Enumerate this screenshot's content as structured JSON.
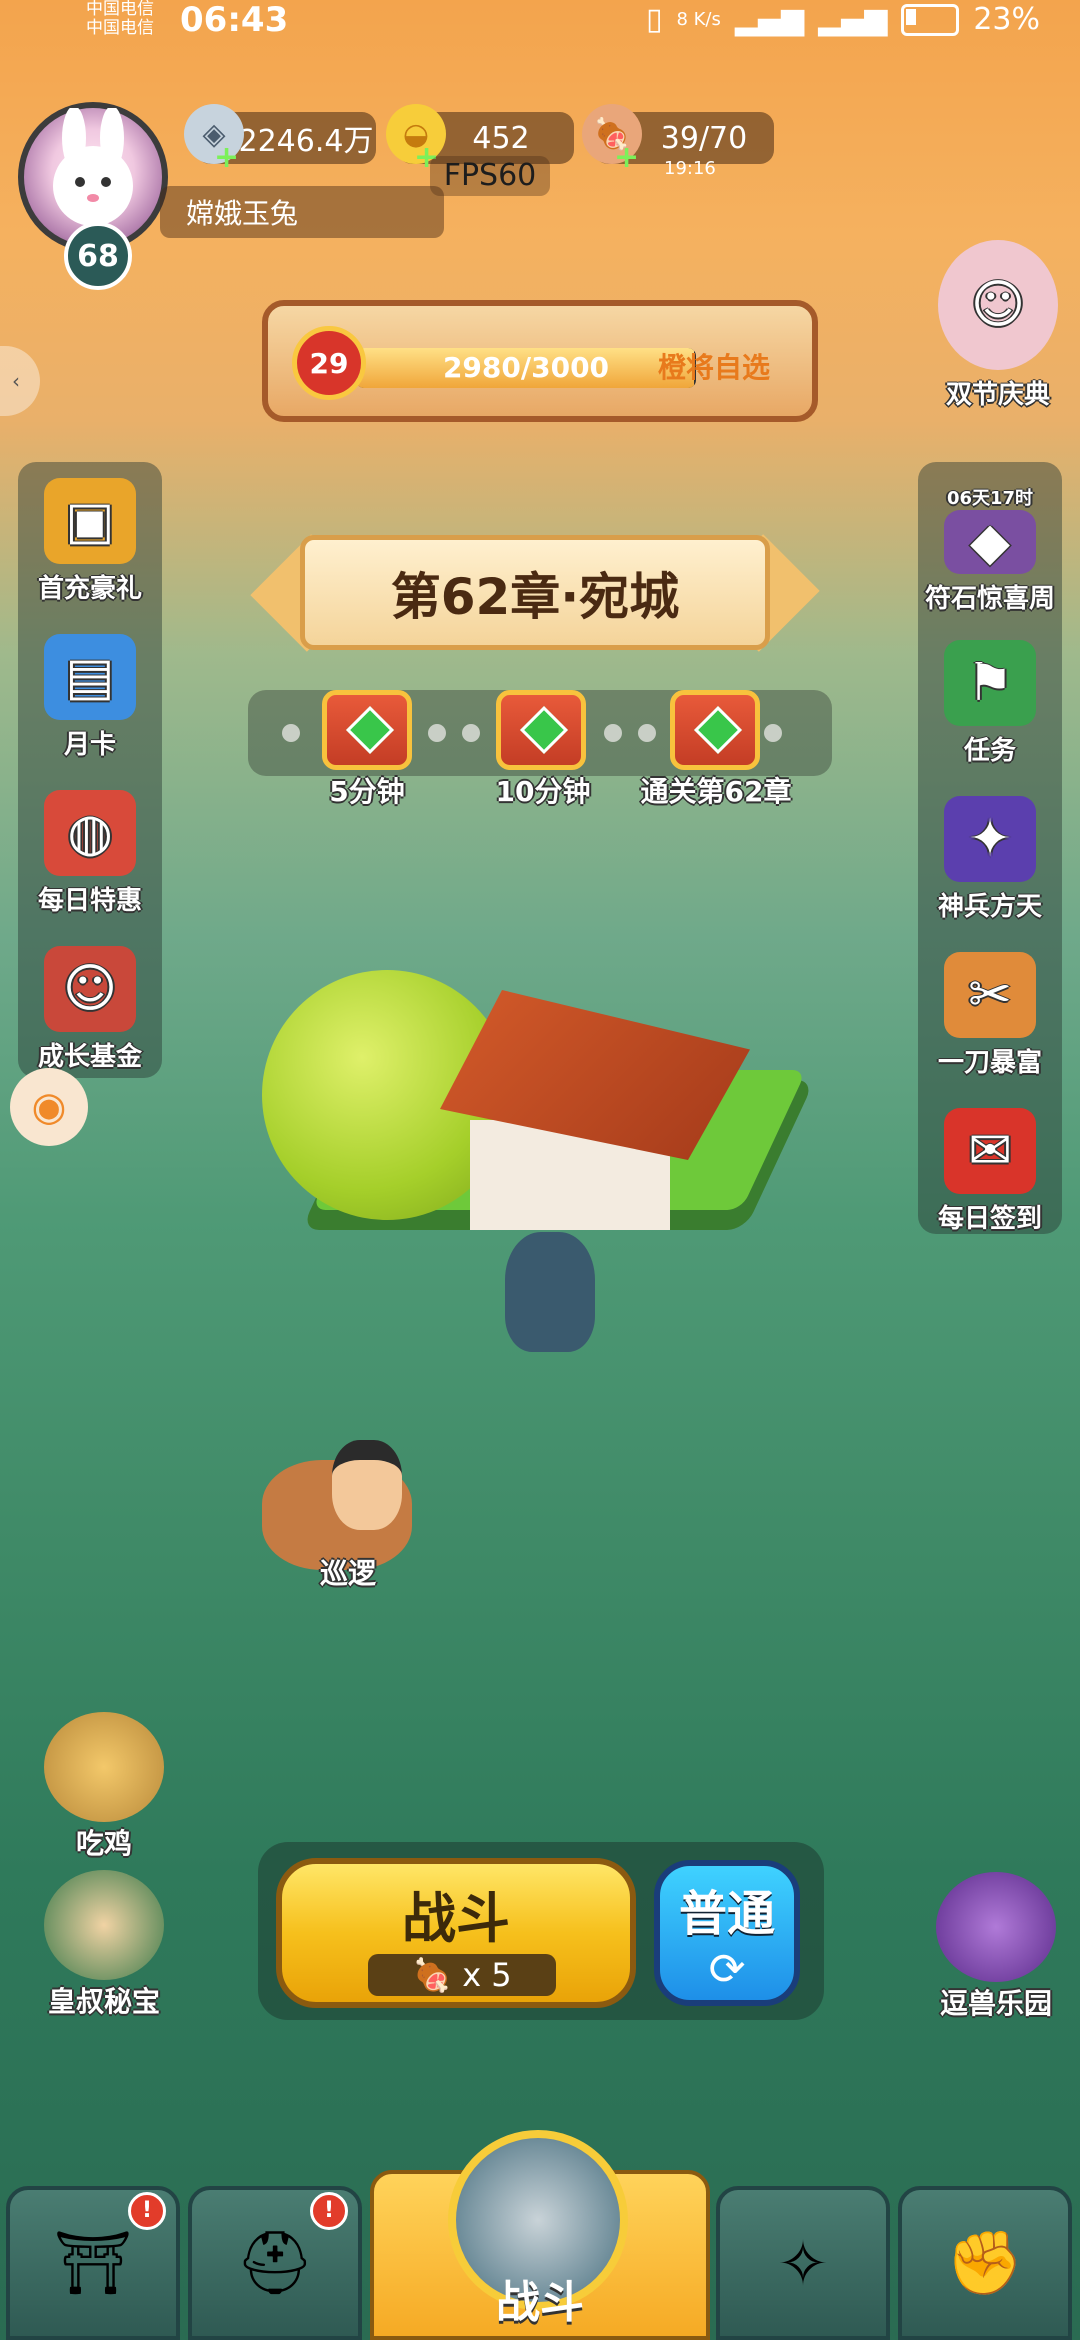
{
  "status": {
    "carrier1": "中国电信",
    "carrier2": "中国电信",
    "time": "06:43",
    "net_speed": "8 K/s",
    "battery": "23%"
  },
  "hud": {
    "level": "68",
    "player_name": "嫦娥玉兔",
    "silver": "2246.4万",
    "gold": "452",
    "fps": "FPS60",
    "stamina": "39/70",
    "stamina_timer": "19:16"
  },
  "level_bar": {
    "badge": "29",
    "progress_text": "2980/3000",
    "progress_ratio": 0.993,
    "select_label": "橙将自选"
  },
  "left_menu": [
    {
      "label": "首充豪礼",
      "icon": "treasure-chest"
    },
    {
      "label": "月卡",
      "icon": "calendar-card"
    },
    {
      "label": "每日特惠",
      "icon": "gift-bag"
    },
    {
      "label": "成长基金",
      "icon": "money-god"
    }
  ],
  "right_menu": [
    {
      "label": "双节庆典",
      "icon": "festival-girl"
    },
    {
      "label": "符石惊喜周",
      "icon": "rune-chest",
      "timer": "06天17时"
    },
    {
      "label": "任务",
      "icon": "scroll-flag"
    },
    {
      "label": "神兵方天",
      "icon": "halberd"
    },
    {
      "label": "一刀暴富",
      "icon": "sale-tag"
    },
    {
      "label": "每日签到",
      "icon": "sign-envelope"
    }
  ],
  "chapter": {
    "title": "第62章·宛城"
  },
  "rewards": [
    {
      "label": "5分钟"
    },
    {
      "label": "10分钟"
    },
    {
      "label": "通关第62章"
    }
  ],
  "scene": {
    "patrol_label": "巡逻"
  },
  "left_bottom": [
    {
      "label": "吃鸡"
    },
    {
      "label": "皇叔秘宝"
    }
  ],
  "right_bottom": {
    "label": "逗兽乐园"
  },
  "battle": {
    "title": "战斗",
    "cost": "x 5",
    "mode": "普通"
  },
  "bottom_nav": {
    "center_label": "战斗",
    "tabs": [
      {
        "icon": "castle-gate",
        "badge": "!"
      },
      {
        "icon": "helmet",
        "badge": "!"
      },
      {
        "icon": "fan-weapon"
      },
      {
        "icon": "upgrade-fist"
      }
    ]
  },
  "colors": {
    "accent_orange": "#e87a1c",
    "battle_yellow": "#f6c01c",
    "mode_blue": "#1e8fe8",
    "badge_red": "#e23c2a"
  }
}
